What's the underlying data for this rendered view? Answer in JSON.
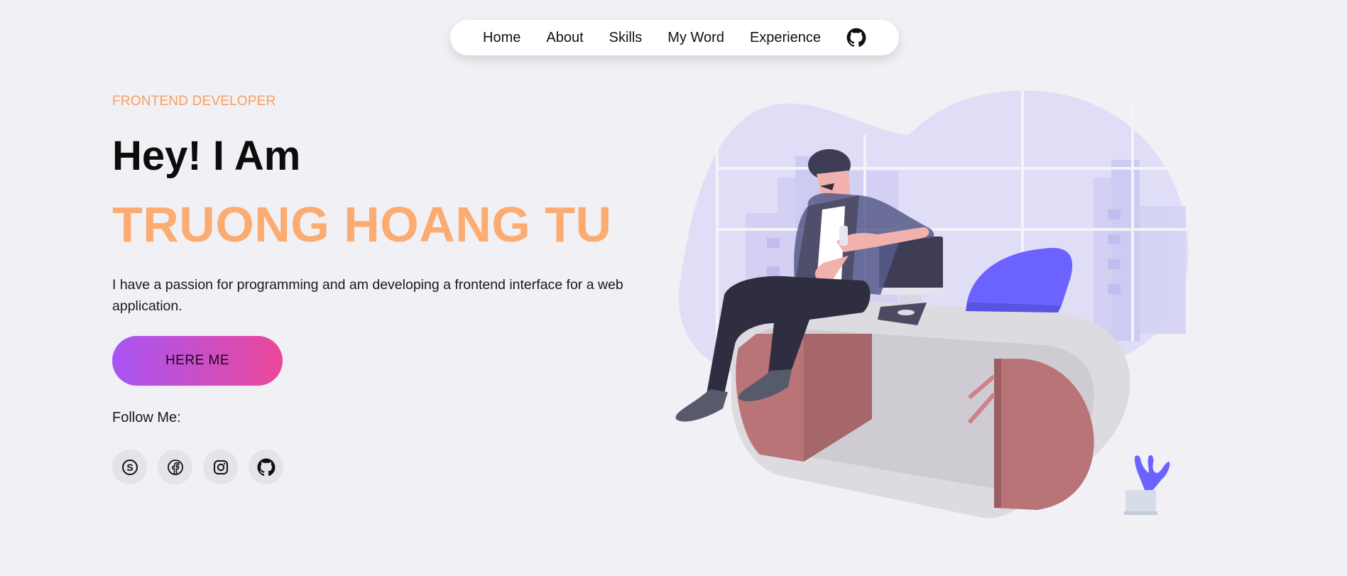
{
  "nav": {
    "items": [
      {
        "label": "Home"
      },
      {
        "label": "About"
      },
      {
        "label": "Skills"
      },
      {
        "label": "My Word"
      },
      {
        "label": "Experience"
      }
    ],
    "github_icon": "github-icon"
  },
  "hero": {
    "role": "FRONTEND DEVELOPER",
    "greeting": "Hey! I Am",
    "name": "TRUONG HOANG TU",
    "description": "I have a passion for programming and am developing a frontend interface for a web application.",
    "cta_label": "HERE ME",
    "follow_label": "Follow Me:",
    "socials": [
      "skype-icon",
      "facebook-icon",
      "instagram-icon",
      "github-icon"
    ]
  },
  "colors": {
    "background": "#f0f0f5",
    "accent_orange": "#fcab71",
    "gradient_start": "#a855f7",
    "gradient_end": "#ec4899"
  }
}
